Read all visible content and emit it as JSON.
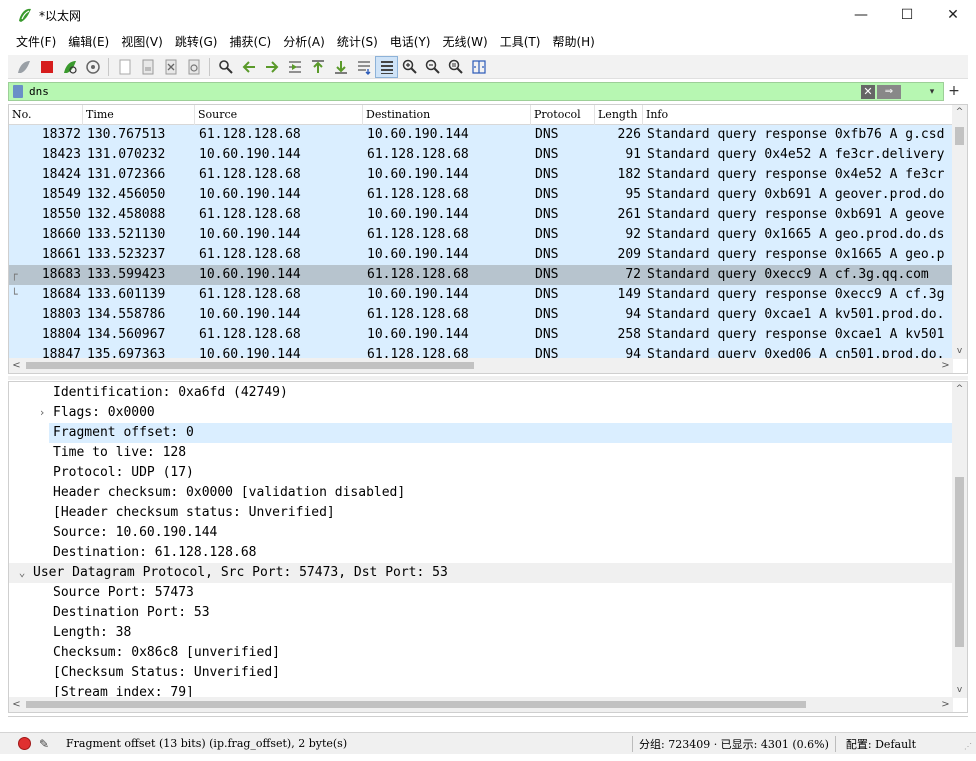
{
  "window": {
    "title": "*以太网",
    "minimize": "—",
    "maximize": "☐",
    "close": "✕"
  },
  "menu": [
    "文件(F)",
    "编辑(E)",
    "视图(V)",
    "跳转(G)",
    "捕获(C)",
    "分析(A)",
    "统计(S)",
    "电话(Y)",
    "无线(W)",
    "工具(T)",
    "帮助(H)"
  ],
  "filter": {
    "value": "dns",
    "apply_label": "⇒",
    "clear_label": "✕",
    "dropdown_label": "▾",
    "add_label": "+"
  },
  "packet_list": {
    "columns": [
      "No.",
      "Time",
      "Source",
      "Destination",
      "Protocol",
      "Length",
      "Info"
    ],
    "rows": [
      {
        "no": "18372",
        "time": "130.767513",
        "src": "61.128.128.68",
        "dst": "10.60.190.144",
        "proto": "DNS",
        "len": "226",
        "info": "Standard query response 0xfb76 A g.csd",
        "selected": false
      },
      {
        "no": "18423",
        "time": "131.070232",
        "src": "10.60.190.144",
        "dst": "61.128.128.68",
        "proto": "DNS",
        "len": "91",
        "info": "Standard query 0x4e52 A fe3cr.delivery",
        "selected": false
      },
      {
        "no": "18424",
        "time": "131.072366",
        "src": "61.128.128.68",
        "dst": "10.60.190.144",
        "proto": "DNS",
        "len": "182",
        "info": "Standard query response 0x4e52 A fe3cr",
        "selected": false
      },
      {
        "no": "18549",
        "time": "132.456050",
        "src": "10.60.190.144",
        "dst": "61.128.128.68",
        "proto": "DNS",
        "len": "95",
        "info": "Standard query 0xb691 A geover.prod.do",
        "selected": false
      },
      {
        "no": "18550",
        "time": "132.458088",
        "src": "61.128.128.68",
        "dst": "10.60.190.144",
        "proto": "DNS",
        "len": "261",
        "info": "Standard query response 0xb691 A geove",
        "selected": false
      },
      {
        "no": "18660",
        "time": "133.521130",
        "src": "10.60.190.144",
        "dst": "61.128.128.68",
        "proto": "DNS",
        "len": "92",
        "info": "Standard query 0x1665 A geo.prod.do.ds",
        "selected": false
      },
      {
        "no": "18661",
        "time": "133.523237",
        "src": "61.128.128.68",
        "dst": "10.60.190.144",
        "proto": "DNS",
        "len": "209",
        "info": "Standard query response 0x1665 A geo.p",
        "selected": false
      },
      {
        "no": "18683",
        "time": "133.599423",
        "src": "10.60.190.144",
        "dst": "61.128.128.68",
        "proto": "DNS",
        "len": "72",
        "info": "Standard query 0xecc9 A cf.3g.qq.com",
        "selected": true
      },
      {
        "no": "18684",
        "time": "133.601139",
        "src": "61.128.128.68",
        "dst": "10.60.190.144",
        "proto": "DNS",
        "len": "149",
        "info": "Standard query response 0xecc9 A cf.3g",
        "selected": false
      },
      {
        "no": "18803",
        "time": "134.558786",
        "src": "10.60.190.144",
        "dst": "61.128.128.68",
        "proto": "DNS",
        "len": "94",
        "info": "Standard query 0xcae1 A kv501.prod.do.",
        "selected": false
      },
      {
        "no": "18804",
        "time": "134.560967",
        "src": "61.128.128.68",
        "dst": "10.60.190.144",
        "proto": "DNS",
        "len": "258",
        "info": "Standard query response 0xcae1 A kv501",
        "selected": false
      },
      {
        "no": "18847",
        "time": "135.697363",
        "src": "10.60.190.144",
        "dst": "61.128.128.68",
        "proto": "DNS",
        "len": "94",
        "info": "Standard query 0xed06 A cn501.prod.do.",
        "selected": false
      }
    ]
  },
  "details": [
    {
      "text": "Identification: 0xa6fd (42749)",
      "level": 1,
      "toggle": "",
      "highlight": false
    },
    {
      "text": "Flags: 0x0000",
      "level": 1,
      "toggle": ">",
      "highlight": false
    },
    {
      "text": "Fragment offset: 0",
      "level": 1,
      "toggle": "",
      "highlight": true
    },
    {
      "text": "Time to live: 128",
      "level": 1,
      "toggle": "",
      "highlight": false
    },
    {
      "text": "Protocol: UDP (17)",
      "level": 1,
      "toggle": "",
      "highlight": false
    },
    {
      "text": "Header checksum: 0x0000 [validation disabled]",
      "level": 1,
      "toggle": "",
      "highlight": false
    },
    {
      "text": "[Header checksum status: Unverified]",
      "level": 1,
      "toggle": "",
      "highlight": false
    },
    {
      "text": "Source: 10.60.190.144",
      "level": 1,
      "toggle": "",
      "highlight": false
    },
    {
      "text": "Destination: 61.128.128.68",
      "level": 1,
      "toggle": "",
      "highlight": false
    },
    {
      "text": "User Datagram Protocol, Src Port: 57473, Dst Port: 53",
      "level": 0,
      "toggle": "v",
      "highlight": false
    },
    {
      "text": "Source Port: 57473",
      "level": 1,
      "toggle": "",
      "highlight": false
    },
    {
      "text": "Destination Port: 53",
      "level": 1,
      "toggle": "",
      "highlight": false
    },
    {
      "text": "Length: 38",
      "level": 1,
      "toggle": "",
      "highlight": false
    },
    {
      "text": "Checksum: 0x86c8 [unverified]",
      "level": 1,
      "toggle": "",
      "highlight": false
    },
    {
      "text": "[Checksum Status: Unverified]",
      "level": 1,
      "toggle": "",
      "highlight": false
    },
    {
      "text": "[Stream index: 79]",
      "level": 1,
      "toggle": "",
      "highlight": false
    }
  ],
  "status": {
    "message": "Fragment offset (13 bits) (ip.frag_offset), 2 byte(s)",
    "stats": "分组: 723409 · 已显示: 4301 (0.6%)",
    "profile": "配置: Default"
  },
  "colors": {
    "row_bg": "#daeeff",
    "row_selected": "#b7c4ce",
    "filter_bg": "#b7f7b2",
    "status_dot": "#e03030"
  }
}
